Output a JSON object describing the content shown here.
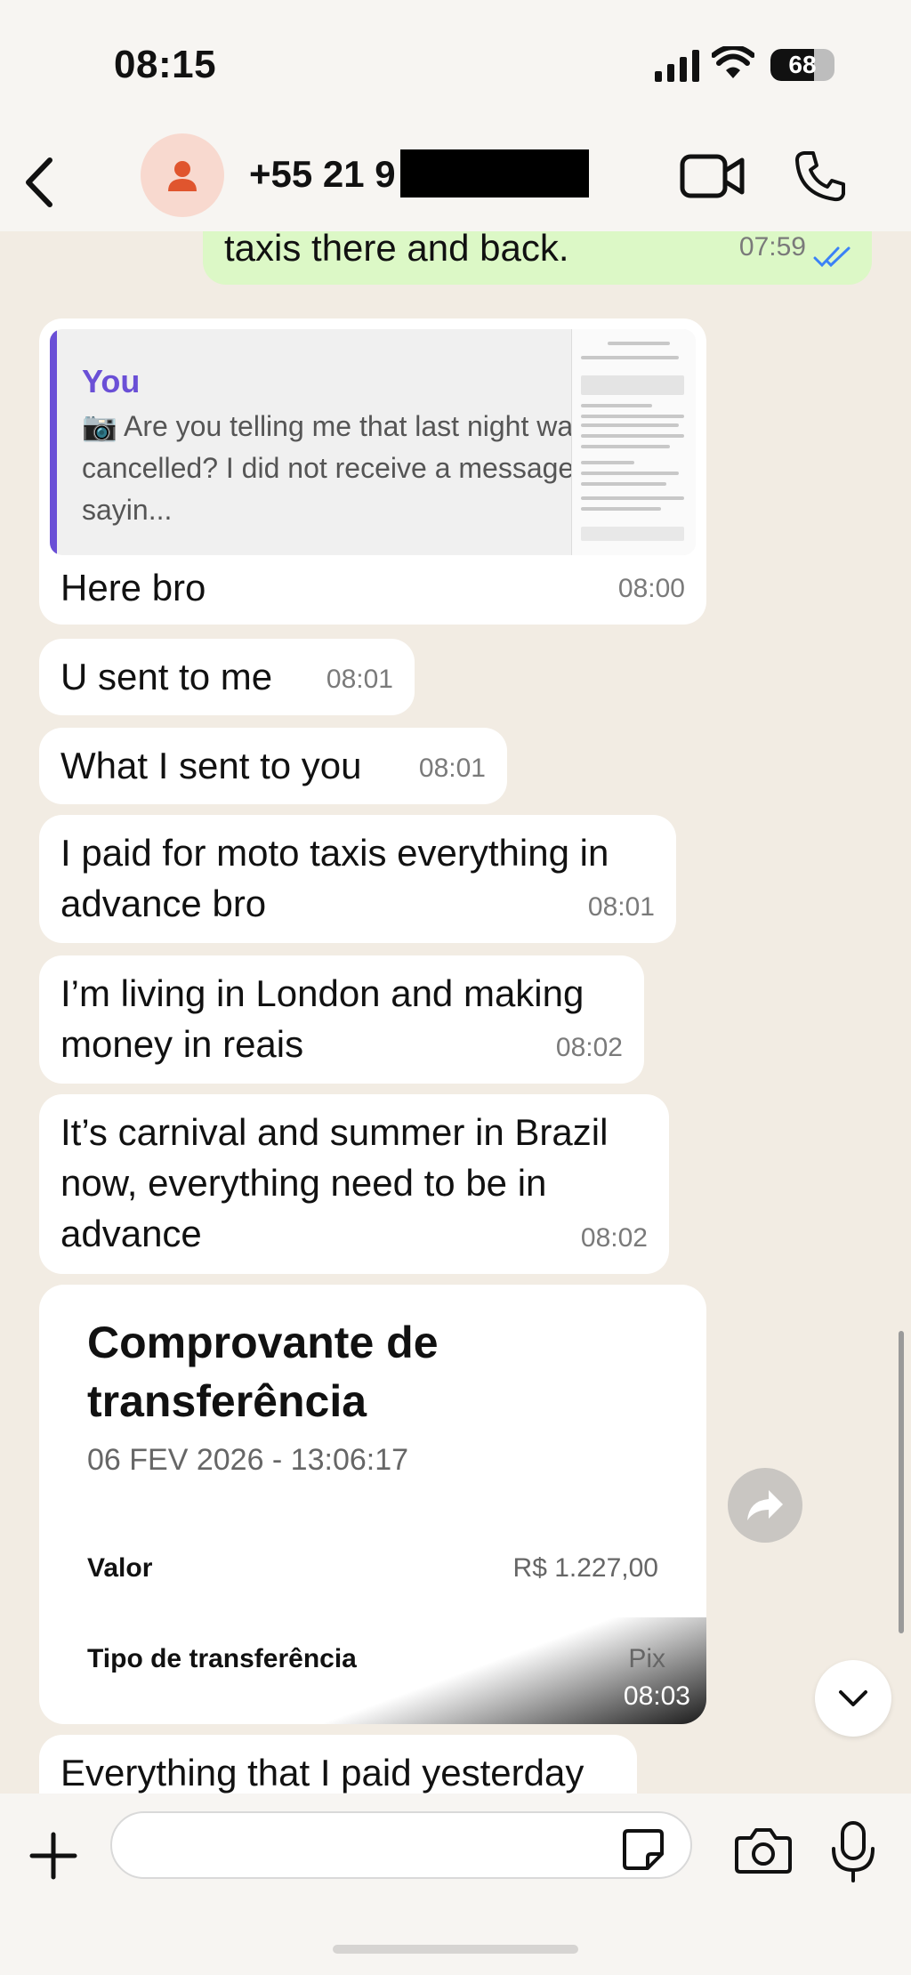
{
  "status_bar": {
    "time": "08:15",
    "battery": "68",
    "icons": [
      "signal-icon",
      "wifi-icon",
      "battery-icon"
    ]
  },
  "header": {
    "contact_name": "+55 21 9",
    "icons": [
      "back-icon",
      "avatar-person-icon",
      "video-call-icon",
      "phone-call-icon"
    ]
  },
  "messages": [
    {
      "direction": "outgoing",
      "text": "taxis there and back.",
      "time": "07:59",
      "status": "read"
    },
    {
      "direction": "incoming",
      "quote": {
        "author": "You",
        "text": "📷 Are you telling me that last night was cancelled? I did not receive a message sayin..."
      },
      "text": "Here bro",
      "time": "08:00"
    },
    {
      "direction": "incoming",
      "text": "U sent to me",
      "time": "08:01"
    },
    {
      "direction": "incoming",
      "text": "What I sent to you",
      "time": "08:01"
    },
    {
      "direction": "incoming",
      "text": "I paid for moto taxis everything in advance bro",
      "time": "08:01"
    },
    {
      "direction": "incoming",
      "text": "I’m living in London and making money in reais",
      "time": "08:02"
    },
    {
      "direction": "incoming",
      "text": "It’s carnival and summer in Brazil now, everything need to be in advance",
      "time": "08:02"
    },
    {
      "direction": "incoming",
      "type": "receipt",
      "title": "Comprovante de transferência",
      "date": "06 FEV 2026 - 13:06:17",
      "rows": [
        {
          "label": "Valor",
          "value": "R$ 1.227,00"
        },
        {
          "label": "Tipo de transferência",
          "value": "Pix"
        }
      ],
      "time": "08:03"
    },
    {
      "direction": "incoming",
      "text": "Everything that I paid yesterday",
      "time": ""
    }
  ],
  "composer": {
    "placeholder": "",
    "icons": [
      "plus-icon",
      "sticker-icon",
      "camera-icon",
      "mic-icon"
    ]
  },
  "colors": {
    "outgoing_bubble": "#dcf8c6",
    "incoming_bubble": "#ffffff",
    "quote_accent": "#6a4fd6",
    "read_receipt": "#3b82f6",
    "chat_background": "#f2ece3"
  }
}
